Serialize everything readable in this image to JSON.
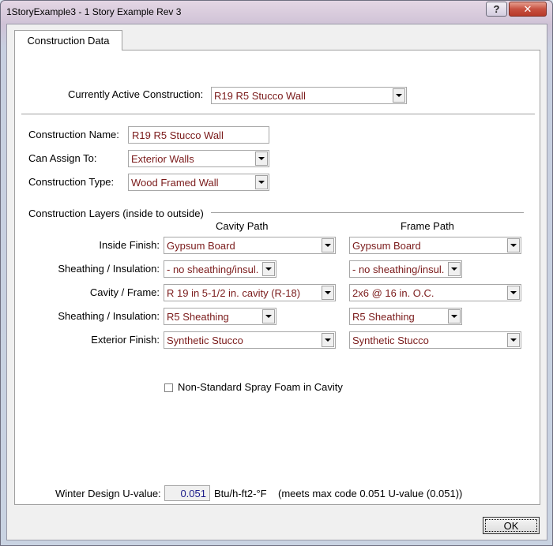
{
  "window": {
    "title": "1StoryExample3 - 1 Story Example Rev 3",
    "help_button": "?",
    "close_button": "✕"
  },
  "tabs": [
    "Construction Data"
  ],
  "active_construction": {
    "label": "Currently Active Construction:",
    "value": "R19 R5 Stucco Wall"
  },
  "construction": {
    "name_label": "Construction Name:",
    "name_value": "R19 R5 Stucco Wall",
    "assign_label": "Can Assign To:",
    "assign_value": "Exterior Walls",
    "type_label": "Construction Type:",
    "type_value": "Wood Framed Wall"
  },
  "layers": {
    "heading": "Construction Layers (inside to outside)",
    "cavity_header": "Cavity Path",
    "frame_header": "Frame Path",
    "rows": [
      {
        "label": "Inside Finish:",
        "cavity": "Gypsum Board",
        "frame": "Gypsum Board"
      },
      {
        "label": "Sheathing / Insulation:",
        "cavity": "- no sheathing/insul.",
        "frame": "- no sheathing/insul."
      },
      {
        "label": "Cavity / Frame:",
        "cavity": "R 19 in 5-1/2 in. cavity (R-18)",
        "frame": "2x6 @ 16 in. O.C."
      },
      {
        "label": "Sheathing / Insulation:",
        "cavity": "R5 Sheathing",
        "frame": "R5 Sheathing"
      },
      {
        "label": "Exterior Finish:",
        "cavity": "Synthetic Stucco",
        "frame": "Synthetic Stucco"
      }
    ]
  },
  "spray_foam": {
    "label": "Non-Standard Spray Foam in Cavity",
    "checked": false
  },
  "uvalue": {
    "label": "Winter Design U-value:",
    "value": "0.051",
    "units": "Btu/h-ft2-°F",
    "note": "(meets max code 0.051 U-value (0.051))"
  },
  "ok_button": "OK"
}
